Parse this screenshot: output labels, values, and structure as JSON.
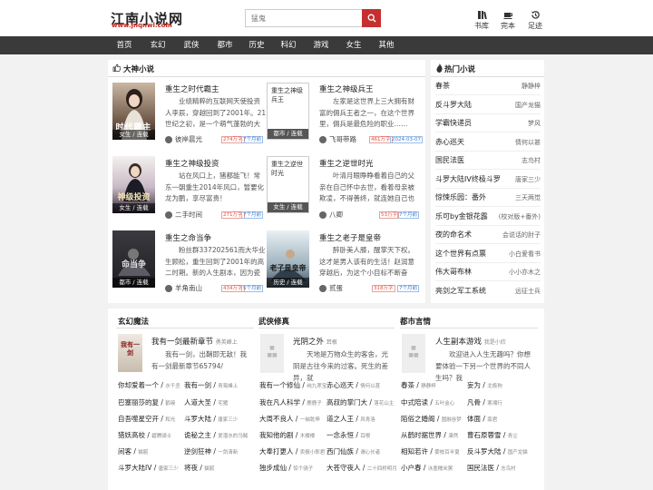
{
  "header": {
    "site_name": "江南小说网",
    "site_url": "www.jnqnwl.com",
    "search_placeholder": "猛鬼",
    "links": [
      {
        "label": "书库",
        "icon": "library-icon"
      },
      {
        "label": "完本",
        "icon": "coffee-cup-icon"
      },
      {
        "label": "足迹",
        "icon": "history-icon"
      }
    ]
  },
  "nav": [
    "首页",
    "玄幻",
    "武侠",
    "都市",
    "历史",
    "科幻",
    "游戏",
    "女生",
    "其他"
  ],
  "featured": {
    "title": "大神小说",
    "books": [
      {
        "title": "重生之时代霸主",
        "desc": "业绩精粹的互联网天使投资人李辰，穿越回到了2001年。21世纪之初，是一个萌气蓬勃的大时代。",
        "author": "彼岸晨光",
        "words": "274万字",
        "date": "7个月前",
        "cover_text": "时代霸主",
        "caption": "女生 / 连载"
      },
      {
        "title": "重生之神级兵王",
        "desc": "左家是这世界上三大拥有财富的佣兵王者之一，在这个世界里，佣兵是最危险的职业……",
        "author": "飞哥带路",
        "words": "461万字",
        "date": "2024-03-07",
        "cover_text": "重生之神级兵王",
        "caption": "都市 / 连载"
      },
      {
        "title": "重生之神级投资",
        "desc": "站在风口上，猪都能飞！常东一朝重生2014年风口，暂要化龙为鹏，享尽富贵！",
        "author": "二手时间",
        "words": "271万字",
        "date": "7个月前",
        "cover_text": "神级投资",
        "caption": "女生 / 连载"
      },
      {
        "title": "重生之逆世时光",
        "desc": "叶清月眼睁睁看着自己的父亲在自己怀中去世，看着母亲被欺凌，不得善终，就连她自己也死在……",
        "author": "八卿",
        "words": "53万字",
        "date": "7个月前",
        "cover_text": "重生之逆世时光",
        "caption": "女生 / 连载"
      },
      {
        "title": "重生之命当争",
        "desc": "粉丝群337202561而大华业生顾松，重生回到了2001年的高二时期。新的人生剧本，因为瓷器的……",
        "author": "羊角南山",
        "words": "434万字",
        "date": "5个月前",
        "cover_text": "命当争",
        "caption": "都市 / 连载"
      },
      {
        "title": "重生之老子是皇帝",
        "desc": "醉卧美人膝，醒掌天下权。这才是男人该有的生活！赵润意穿越后，为这个小目标不断奋斗。",
        "author": "贰蛋",
        "words": "318万字",
        "date": "7个月前",
        "cover_text": "老子是皇帝",
        "caption": "历史 / 连载"
      }
    ]
  },
  "hot": {
    "title": "热门小说",
    "items": [
      {
        "name": "春茶",
        "author": "静静梓"
      },
      {
        "name": "反斗罗大陆",
        "author": "国产龙猫"
      },
      {
        "name": "学霸快递员",
        "author": "梦风"
      },
      {
        "name": "赤心巡天",
        "author": "情何以甚"
      },
      {
        "name": "国民法医",
        "author": "志鸟村"
      },
      {
        "name": "斗罗大陆IV终极斗罗",
        "author": "唐家三少"
      },
      {
        "name": "惊悚乐园：番外",
        "author": "三天两觉"
      },
      {
        "name": "乐可by金银花露",
        "author": "(校对版+番外)"
      },
      {
        "name": "夜的命名术",
        "author": "会说话的肘子"
      },
      {
        "name": "这个世界有点票",
        "author": "小白爱看书"
      },
      {
        "name": "伟大哥布林",
        "author": "小小亦木之"
      },
      {
        "name": "亮剑之军工系统",
        "author": "远征士兵"
      }
    ]
  },
  "sections": [
    {
      "title": "玄幻魔法",
      "top": {
        "name": "我有一剑最新章节",
        "author": "勇英峰上",
        "desc": "我有一剑，出鞘即无敌！我有一剑最新章节65794/",
        "cover_text": "我有一剑"
      },
      "list": [
        {
          "name": "你却爱着一个",
          "meta": "水千丞"
        },
        {
          "name": "我有一剑",
          "meta": "青鸾峰上"
        },
        {
          "name": "巴塞丽莎的复",
          "meta": "鹤唳"
        },
        {
          "name": "人道大圣",
          "meta": "宅猪"
        },
        {
          "name": "自吾噬星空开",
          "meta": "和光"
        },
        {
          "name": "斗罗大陆",
          "meta": "唐家三少"
        },
        {
          "name": "猎妖高校",
          "meta": "碧腾骑士"
        },
        {
          "name": "诡秘之主",
          "meta": "爱潜水的乌贼"
        },
        {
          "name": "间客",
          "meta": "猫腻"
        },
        {
          "name": "逆剑狂神",
          "meta": "一剑清新"
        },
        {
          "name": "斗罗大陆IV",
          "meta": "唐家三少"
        },
        {
          "name": "将夜",
          "meta": "猫腻"
        }
      ]
    },
    {
      "title": "武侠修真",
      "top": {
        "name": "光阴之外",
        "author": "耳根",
        "desc": "天地是万物众生的客舍，光阴是古往今来的过客。死生的差异，就",
        "cover_text": ""
      },
      "list": [
        {
          "name": "我有一个修仙",
          "meta": "纯九莲宝"
        },
        {
          "name": "赤心巡天",
          "meta": "情何以甚"
        },
        {
          "name": "我在凡人科学",
          "meta": "鹿鹿子"
        },
        {
          "name": "高叔的掌门大",
          "meta": "落花山主"
        },
        {
          "name": "大周不良人",
          "meta": "一袖乾坤"
        },
        {
          "name": "道之人王",
          "meta": "风青洛"
        },
        {
          "name": "我知他的剧",
          "meta": "木楼楼"
        },
        {
          "name": "一念永恒",
          "meta": "耳根"
        },
        {
          "name": "大奉打更人",
          "meta": "卖报小郎君"
        },
        {
          "name": "西门仙族",
          "meta": "谓心长者"
        },
        {
          "name": "独步成仙",
          "meta": "惊个骑子"
        },
        {
          "name": "大苍守夜人",
          "meta": "二十四桥明月"
        }
      ]
    },
    {
      "title": "都市言情",
      "top": {
        "name": "人生副本游戏",
        "author": "我是小欣",
        "desc": "欢迎进入人生无趣吗？你想要体验一下另一个世界的不同人生吗？我",
        "cover_text": ""
      },
      "list": [
        {
          "name": "春茶",
          "meta": "静静梓"
        },
        {
          "name": "妄为",
          "meta": "北极狗"
        },
        {
          "name": "中式陪读",
          "meta": "五叶金心"
        },
        {
          "name": "凡骨",
          "meta": "寒湘行"
        },
        {
          "name": "陌俗之婚阁",
          "meta": "圆融谷梦"
        },
        {
          "name": "体面",
          "meta": "南君"
        },
        {
          "name": "从鹤时据世界",
          "meta": "漠然"
        },
        {
          "name": "曹石原蓉雪",
          "meta": "青尘"
        },
        {
          "name": "相知若许",
          "meta": "雾枝百半夏"
        },
        {
          "name": "反斗罗大陆",
          "meta": "国产龙猫"
        },
        {
          "name": "小户春",
          "meta": "冰墨糯米粥"
        },
        {
          "name": "国民法医",
          "meta": "志鸟村"
        }
      ]
    }
  ]
}
